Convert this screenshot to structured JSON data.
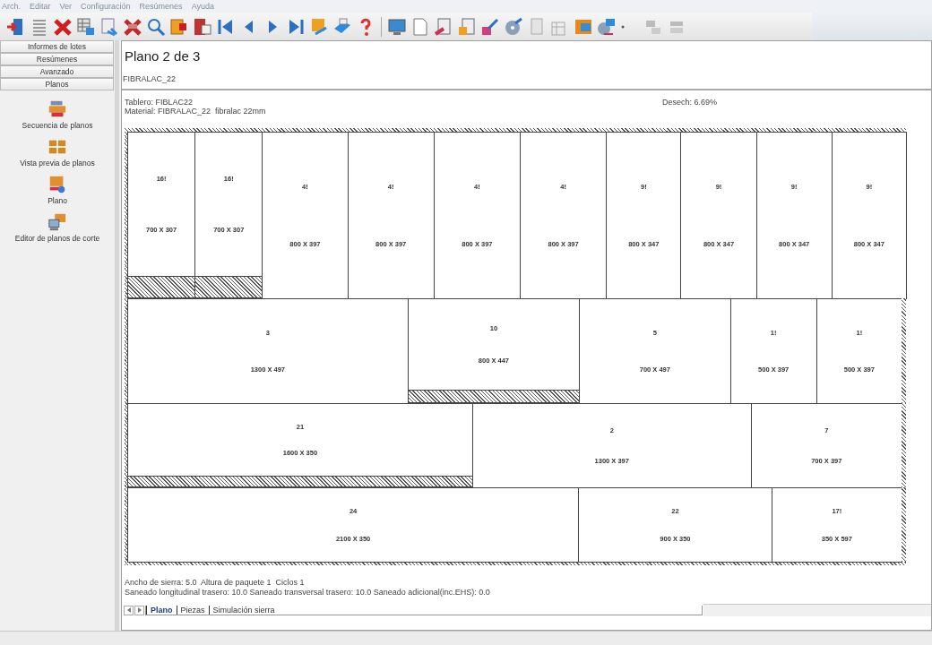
{
  "menu": [
    "Arch.",
    "Editar",
    "Ver",
    "Configuración",
    "Resúmenes",
    "Ayuda"
  ],
  "sidebar": {
    "sections": [
      {
        "label": "Informes de lotes"
      },
      {
        "label": "Resúmenes"
      },
      {
        "label": "Avanzado"
      },
      {
        "label": "Planos"
      }
    ],
    "items": [
      {
        "label": "Secuencia de planos"
      },
      {
        "label": "Vista previa de planos"
      },
      {
        "label": "Plano"
      },
      {
        "label": "Editor de planos de corte"
      }
    ]
  },
  "plan": {
    "title": "Plano 2 de 3",
    "material_code": "FIBRALAC_22",
    "board": "Tablero: FIBLAC22",
    "material": "Material: FIBRALAC_22  fibralac 22mm",
    "waste": "Desech: 6.69%"
  },
  "strips": [
    {
      "edge_waste": false,
      "pieces": [
        {
          "number": "16!",
          "size": "700 X 307",
          "waste": true
        },
        {
          "number": "16!",
          "size": "700 X 307",
          "waste": true
        },
        {
          "number": "4!",
          "size": "800 X 397",
          "waste": false
        },
        {
          "number": "4!",
          "size": "800 X 397",
          "waste": false
        },
        {
          "number": "4!",
          "size": "800 X 397",
          "waste": false
        },
        {
          "number": "4!",
          "size": "800 X 397",
          "waste": false
        },
        {
          "number": "9!",
          "size": "800 X 347",
          "waste": false
        },
        {
          "number": "9!",
          "size": "800 X 347",
          "waste": false
        },
        {
          "number": "9!",
          "size": "800 X 347",
          "waste": false
        },
        {
          "number": "9!",
          "size": "800 X 347",
          "waste": false
        }
      ]
    },
    {
      "edge_waste": true,
      "pieces": [
        {
          "number": "3",
          "size": "1300 X 497",
          "waste": false
        },
        {
          "number": "10",
          "size": "800 X 447",
          "waste": true
        },
        {
          "number": "5",
          "size": "700 X 497",
          "waste": false
        },
        {
          "number": "1!",
          "size": "500 X 397",
          "waste": false
        },
        {
          "number": "1!",
          "size": "500 X 397",
          "waste": false
        }
      ]
    },
    {
      "edge_waste": true,
      "pieces": [
        {
          "number": "21",
          "size": "1600 X 350",
          "waste": true
        },
        {
          "number": "2",
          "size": "1300 X 397",
          "waste": false
        },
        {
          "number": "7",
          "size": "700 X 397",
          "waste": false
        }
      ]
    },
    {
      "edge_waste": true,
      "pieces": [
        {
          "number": "24",
          "size": "2100 X 350",
          "waste": false
        },
        {
          "number": "22",
          "size": "900 X 350",
          "waste": false
        },
        {
          "number": "17!",
          "size": "350 X 597",
          "waste": false
        }
      ]
    }
  ],
  "footer": [
    "Ancho de sierra: 5.0  Altura de paquete 1  Ciclos 1",
    "Saneado longitudinal trasero: 10.0 Saneado transversal trasero: 10.0 Saneado adicional(inc.EHS): 0.0"
  ],
  "tabs": [
    {
      "label": "Plano",
      "selected": true
    },
    {
      "label": "Piezas",
      "selected": false
    },
    {
      "label": "Simulación sierra",
      "selected": false
    }
  ]
}
